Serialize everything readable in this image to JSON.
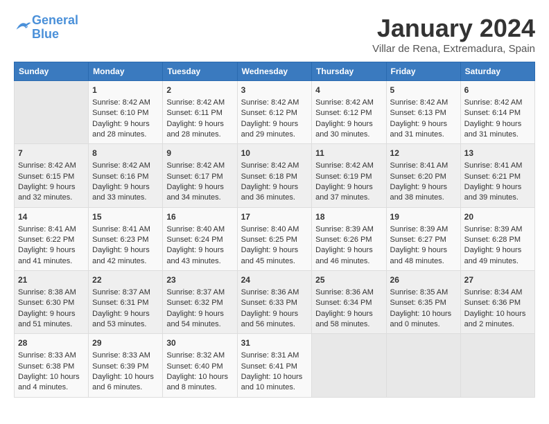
{
  "header": {
    "logo_line1": "General",
    "logo_line2": "Blue",
    "title": "January 2024",
    "subtitle": "Villar de Rena, Extremadura, Spain"
  },
  "weekdays": [
    "Sunday",
    "Monday",
    "Tuesday",
    "Wednesday",
    "Thursday",
    "Friday",
    "Saturday"
  ],
  "weeks": [
    [
      {
        "day": "",
        "data": ""
      },
      {
        "day": "1",
        "data": "Sunrise: 8:42 AM\nSunset: 6:10 PM\nDaylight: 9 hours\nand 28 minutes."
      },
      {
        "day": "2",
        "data": "Sunrise: 8:42 AM\nSunset: 6:11 PM\nDaylight: 9 hours\nand 28 minutes."
      },
      {
        "day": "3",
        "data": "Sunrise: 8:42 AM\nSunset: 6:12 PM\nDaylight: 9 hours\nand 29 minutes."
      },
      {
        "day": "4",
        "data": "Sunrise: 8:42 AM\nSunset: 6:12 PM\nDaylight: 9 hours\nand 30 minutes."
      },
      {
        "day": "5",
        "data": "Sunrise: 8:42 AM\nSunset: 6:13 PM\nDaylight: 9 hours\nand 31 minutes."
      },
      {
        "day": "6",
        "data": "Sunrise: 8:42 AM\nSunset: 6:14 PM\nDaylight: 9 hours\nand 31 minutes."
      }
    ],
    [
      {
        "day": "7",
        "data": "Sunrise: 8:42 AM\nSunset: 6:15 PM\nDaylight: 9 hours\nand 32 minutes."
      },
      {
        "day": "8",
        "data": "Sunrise: 8:42 AM\nSunset: 6:16 PM\nDaylight: 9 hours\nand 33 minutes."
      },
      {
        "day": "9",
        "data": "Sunrise: 8:42 AM\nSunset: 6:17 PM\nDaylight: 9 hours\nand 34 minutes."
      },
      {
        "day": "10",
        "data": "Sunrise: 8:42 AM\nSunset: 6:18 PM\nDaylight: 9 hours\nand 36 minutes."
      },
      {
        "day": "11",
        "data": "Sunrise: 8:42 AM\nSunset: 6:19 PM\nDaylight: 9 hours\nand 37 minutes."
      },
      {
        "day": "12",
        "data": "Sunrise: 8:41 AM\nSunset: 6:20 PM\nDaylight: 9 hours\nand 38 minutes."
      },
      {
        "day": "13",
        "data": "Sunrise: 8:41 AM\nSunset: 6:21 PM\nDaylight: 9 hours\nand 39 minutes."
      }
    ],
    [
      {
        "day": "14",
        "data": "Sunrise: 8:41 AM\nSunset: 6:22 PM\nDaylight: 9 hours\nand 41 minutes."
      },
      {
        "day": "15",
        "data": "Sunrise: 8:41 AM\nSunset: 6:23 PM\nDaylight: 9 hours\nand 42 minutes."
      },
      {
        "day": "16",
        "data": "Sunrise: 8:40 AM\nSunset: 6:24 PM\nDaylight: 9 hours\nand 43 minutes."
      },
      {
        "day": "17",
        "data": "Sunrise: 8:40 AM\nSunset: 6:25 PM\nDaylight: 9 hours\nand 45 minutes."
      },
      {
        "day": "18",
        "data": "Sunrise: 8:39 AM\nSunset: 6:26 PM\nDaylight: 9 hours\nand 46 minutes."
      },
      {
        "day": "19",
        "data": "Sunrise: 8:39 AM\nSunset: 6:27 PM\nDaylight: 9 hours\nand 48 minutes."
      },
      {
        "day": "20",
        "data": "Sunrise: 8:39 AM\nSunset: 6:28 PM\nDaylight: 9 hours\nand 49 minutes."
      }
    ],
    [
      {
        "day": "21",
        "data": "Sunrise: 8:38 AM\nSunset: 6:30 PM\nDaylight: 9 hours\nand 51 minutes."
      },
      {
        "day": "22",
        "data": "Sunrise: 8:37 AM\nSunset: 6:31 PM\nDaylight: 9 hours\nand 53 minutes."
      },
      {
        "day": "23",
        "data": "Sunrise: 8:37 AM\nSunset: 6:32 PM\nDaylight: 9 hours\nand 54 minutes."
      },
      {
        "day": "24",
        "data": "Sunrise: 8:36 AM\nSunset: 6:33 PM\nDaylight: 9 hours\nand 56 minutes."
      },
      {
        "day": "25",
        "data": "Sunrise: 8:36 AM\nSunset: 6:34 PM\nDaylight: 9 hours\nand 58 minutes."
      },
      {
        "day": "26",
        "data": "Sunrise: 8:35 AM\nSunset: 6:35 PM\nDaylight: 10 hours\nand 0 minutes."
      },
      {
        "day": "27",
        "data": "Sunrise: 8:34 AM\nSunset: 6:36 PM\nDaylight: 10 hours\nand 2 minutes."
      }
    ],
    [
      {
        "day": "28",
        "data": "Sunrise: 8:33 AM\nSunset: 6:38 PM\nDaylight: 10 hours\nand 4 minutes."
      },
      {
        "day": "29",
        "data": "Sunrise: 8:33 AM\nSunset: 6:39 PM\nDaylight: 10 hours\nand 6 minutes."
      },
      {
        "day": "30",
        "data": "Sunrise: 8:32 AM\nSunset: 6:40 PM\nDaylight: 10 hours\nand 8 minutes."
      },
      {
        "day": "31",
        "data": "Sunrise: 8:31 AM\nSunset: 6:41 PM\nDaylight: 10 hours\nand 10 minutes."
      },
      {
        "day": "",
        "data": ""
      },
      {
        "day": "",
        "data": ""
      },
      {
        "day": "",
        "data": ""
      }
    ]
  ]
}
